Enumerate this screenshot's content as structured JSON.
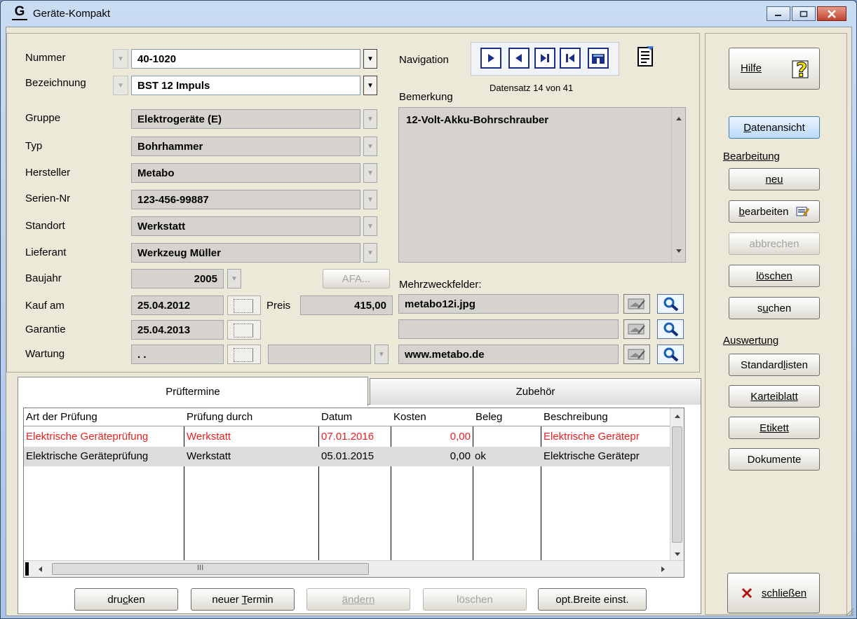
{
  "window": {
    "title": "Geräte-Kompakt",
    "app_icon_glyph": "G"
  },
  "form": {
    "nummer_label": "Nummer",
    "nummer_value": "40-1020",
    "bezeichnung_label": "Bezeichnung",
    "bezeichnung_value": "BST 12  Impuls",
    "gruppe_label": "Gruppe",
    "gruppe_value": "Elektrogeräte (E)",
    "typ_label": "Typ",
    "typ_value": "Bohrhammer",
    "hersteller_label": "Hersteller",
    "hersteller_value": "Metabo",
    "serien_label": "Serien-Nr",
    "serien_value": "123-456-99887",
    "standort_label": "Standort",
    "standort_value": "Werkstatt",
    "lieferant_label": "Lieferant",
    "lieferant_value": "Werkzeug Müller",
    "baujahr_label": "Baujahr",
    "baujahr_value": "2005",
    "afa_button": "AFA...",
    "kauf_label": "Kauf am",
    "kauf_value": "25.04.2012",
    "preis_label": "Preis",
    "preis_value": "415,00",
    "garantie_label": "Garantie",
    "garantie_value": "25.04.2013",
    "wartung_label": "Wartung",
    "wartung_value": ". .",
    "wartung_interval_value": ""
  },
  "navigation": {
    "label": "Navigation",
    "record_info": "Datensatz 14 von 41"
  },
  "bemerkung": {
    "label": "Bemerkung",
    "text": "12-Volt-Akku-Bohrschrauber"
  },
  "mehrzweck": {
    "label": "Mehrzweckfelder:",
    "fields": [
      "metabo12i.jpg",
      "",
      "www.metabo.de"
    ]
  },
  "tabs": {
    "active": "Prüftermine",
    "inactive": "Zubehör"
  },
  "grid": {
    "headers": [
      "Art der Prüfung",
      "Prüfung durch",
      "Datum",
      "Kosten",
      "Beleg",
      "Beschreibung"
    ],
    "rows": [
      [
        "Elektrische Geräteprüfung",
        "Werkstatt",
        "07.01.2016",
        "0,00",
        "",
        "Elektrische Gerätepr"
      ],
      [
        "Elektrische Geräteprüfung",
        "Werkstatt",
        "05.01.2015",
        "0,00",
        "ok",
        "Elektrische Gerätepr"
      ]
    ],
    "hscroll_grip": "III"
  },
  "bottom_buttons": {
    "drucken": "drucken",
    "neuer_termin": "neuer Termin",
    "aendern": "ändern",
    "loeschen": "löschen",
    "opt_breite": "opt.Breite einst."
  },
  "side": {
    "hilfe": "Hilfe",
    "datenansicht": "Datenansicht",
    "bearbeitung_header": "Bearbeitung",
    "neu": "neu",
    "bearbeiten": "bearbeiten",
    "abbrechen": "abbrechen",
    "loeschen": "löschen",
    "suchen": "suchen",
    "auswertung_header": "Auswertung",
    "standardlisten": "Standardlisten",
    "karteiblatt": "Karteiblatt",
    "etikett": "Etikett",
    "dokumente": "Dokumente",
    "schliessen": "schließen"
  },
  "colors": {
    "accent_red": "#e8211f",
    "nav_blue": "#1b2f86",
    "selected_blue": "#bcdaf8"
  }
}
